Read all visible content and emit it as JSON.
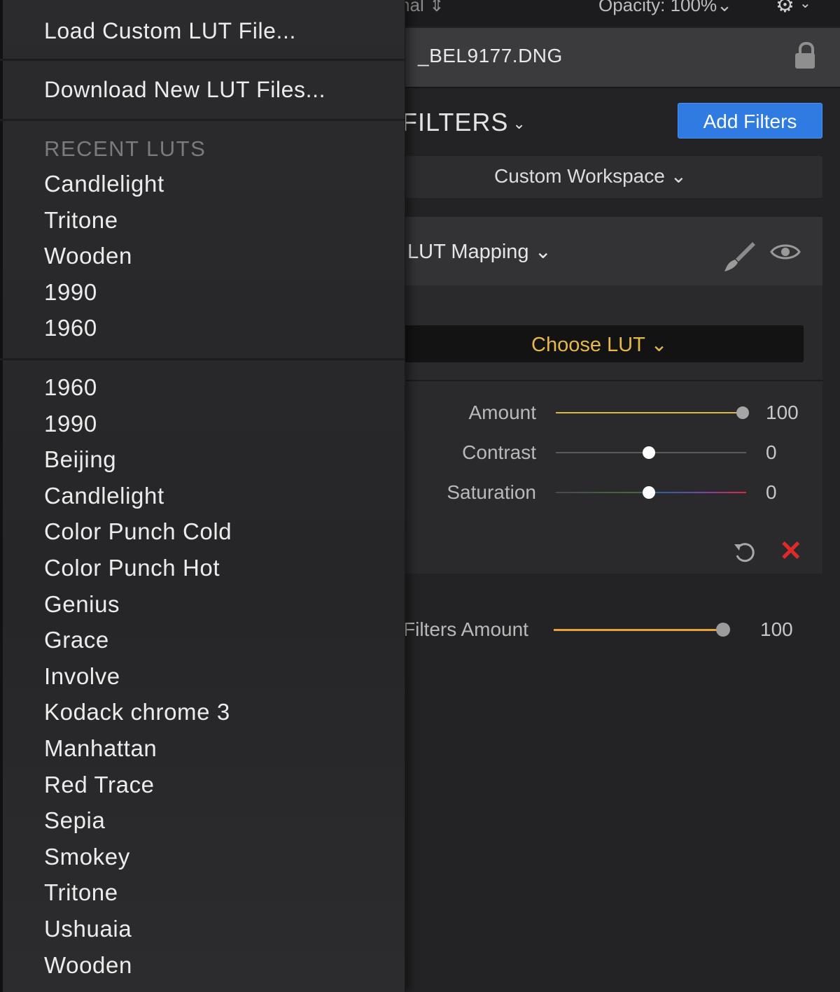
{
  "topbar": {
    "blend_mode": "Normal",
    "blend_chevron": "⇕",
    "opacity": "Opacity: 100%",
    "opacity_chevron": "⌄",
    "gear": "⚙",
    "gear_chevron": "⌄"
  },
  "file": {
    "name": "_BEL9177.DNG"
  },
  "filters": {
    "title": "FILTERS",
    "chevron": "⌄",
    "add_button": "Add Filters",
    "workspace": "Custom Workspace ⌄"
  },
  "lut_filter": {
    "title": "LUT Mapping ⌄",
    "choose_lut": "Choose LUT ⌄",
    "sliders": [
      {
        "label": "Amount",
        "value": "100",
        "level": 1.0
      },
      {
        "label": "Contrast",
        "value": "0",
        "level": 0.5
      },
      {
        "label": "Saturation",
        "value": "0",
        "level": 0.5
      }
    ],
    "delete_glyph": "✕"
  },
  "filters_amount": {
    "label": "Filters Amount",
    "value": "100",
    "level": 1.0
  },
  "menu": {
    "load_custom": "Load Custom LUT File...",
    "download_new": "Download New LUT Files...",
    "recent_header": "RECENT LUTS",
    "recent": [
      "Candlelight",
      "Tritone",
      "Wooden",
      "1990",
      "1960"
    ],
    "all": [
      "1960",
      "1990",
      "Beijing",
      "Candlelight",
      "Color Punch Cold",
      "Color Punch Hot",
      "Genius",
      "Grace",
      "Involve",
      "Kodack chrome  3",
      "Manhattan",
      "Red Trace",
      "Sepia",
      "Smokey",
      "Tritone",
      "Ushuaia",
      "Wooden"
    ]
  },
  "colors": {
    "accent_blue": "#2f7be2",
    "choose_lut_yellow": "#e6b84a",
    "amount_track": "#e8a23a",
    "delete_red": "#e02a2a"
  }
}
